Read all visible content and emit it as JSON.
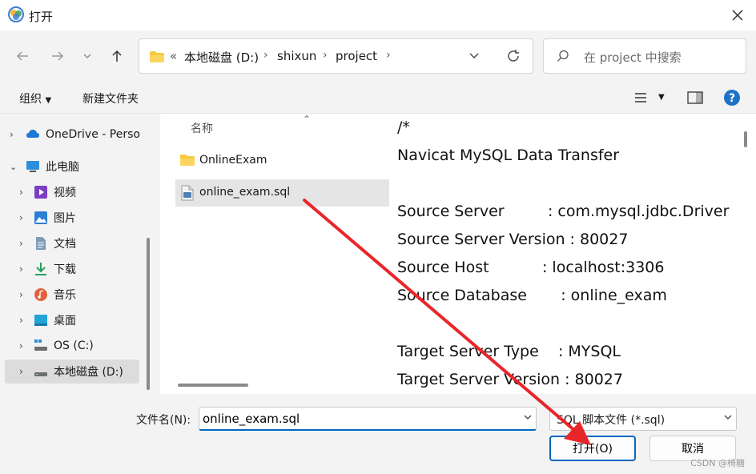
{
  "window": {
    "title": "打开"
  },
  "nav": {
    "breadcrumbs": [
      "«",
      "本地磁盘 (D:)",
      "shixun",
      "project"
    ],
    "search_placeholder": "在 project 中搜索"
  },
  "toolbar": {
    "organize": "组织",
    "new_folder": "新建文件夹"
  },
  "sidebar": {
    "items": [
      {
        "label": "OneDrive - Perso",
        "icon": "cloud-icon"
      },
      {
        "label": "此电脑",
        "icon": "computer-icon"
      },
      {
        "label": "视频",
        "icon": "video-icon"
      },
      {
        "label": "图片",
        "icon": "picture-icon"
      },
      {
        "label": "文档",
        "icon": "document-icon"
      },
      {
        "label": "下载",
        "icon": "download-icon"
      },
      {
        "label": "音乐",
        "icon": "music-icon"
      },
      {
        "label": "桌面",
        "icon": "desktop-icon"
      },
      {
        "label": "OS (C:)",
        "icon": "drive-icon"
      },
      {
        "label": "本地磁盘 (D:)",
        "icon": "drive-icon"
      }
    ]
  },
  "filelist": {
    "column": "名称",
    "files": [
      {
        "name": "OnlineExam",
        "type": "folder"
      },
      {
        "name": "online_exam.sql",
        "type": "sql-file"
      }
    ]
  },
  "preview": {
    "lines": [
      "/*",
      "Navicat MySQL Data Transfer",
      "",
      "Source Server         : com.mysql.jdbc.Driver",
      "Source Server Version : 80027",
      "Source Host           : localhost:3306",
      "Source Database       : online_exam",
      "",
      "Target Server Type    : MYSQL",
      "Target Server Version : 80027"
    ]
  },
  "bottom": {
    "filename_label": "文件名(N):",
    "filename_value": "online_exam.sql",
    "filetype": "SQL 脚本文件 (*.sql)",
    "open_label": "打开(O)",
    "cancel_label": "取消",
    "watermark": "CSDN @椅糖"
  },
  "colors": {
    "accent": "#0067c0",
    "annotation": "#e8262a"
  }
}
